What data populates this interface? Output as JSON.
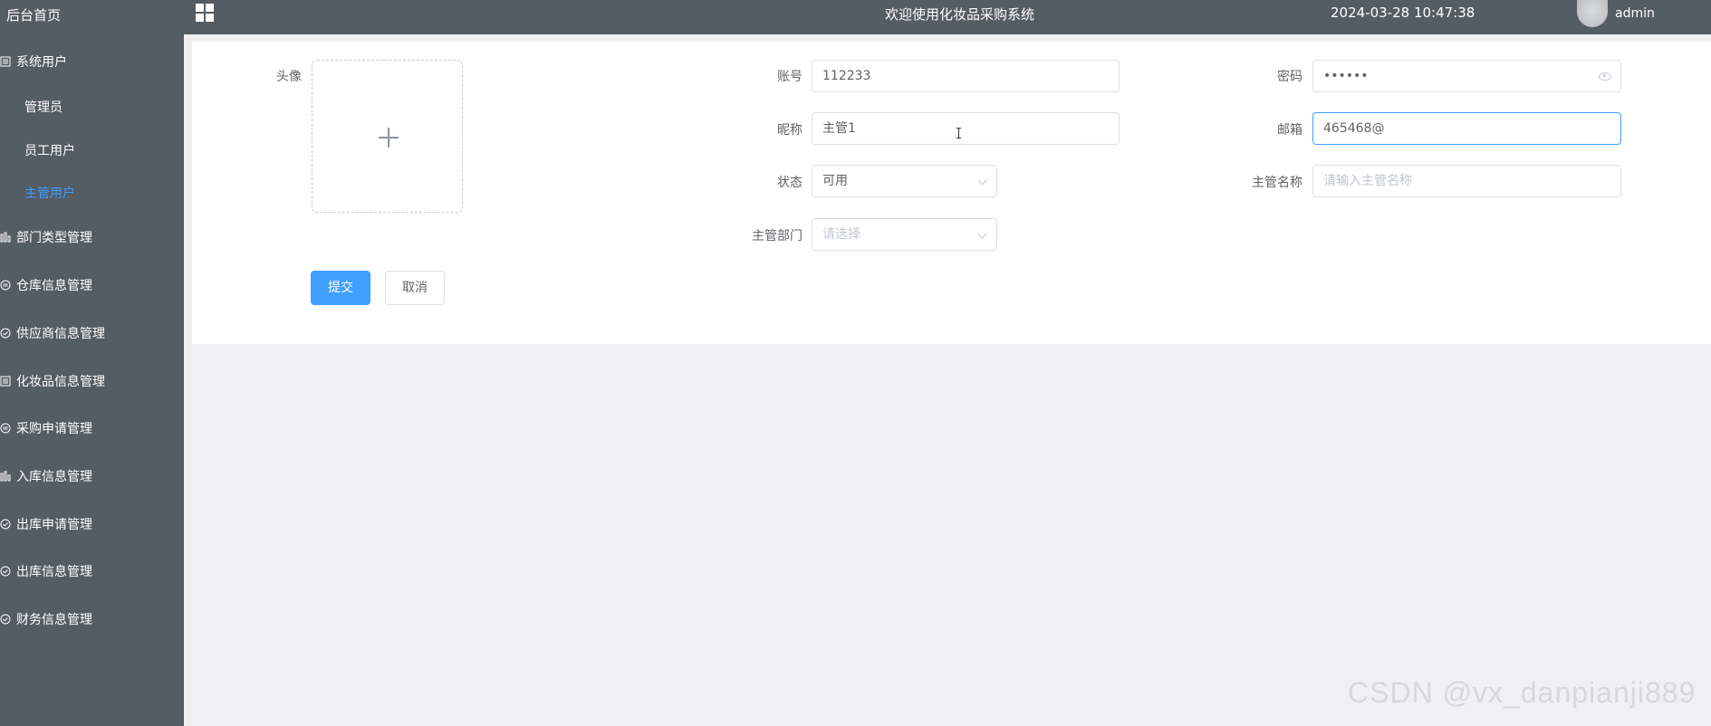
{
  "sidebar": {
    "home": "后台首页",
    "groups": [
      {
        "label": "系统用户",
        "icon": "list-icon"
      },
      {
        "label": "部门类型管理",
        "icon": "bar-chart-icon"
      },
      {
        "label": "仓库信息管理",
        "icon": "message-icon"
      },
      {
        "label": "供应商信息管理",
        "icon": "check-circle-icon"
      },
      {
        "label": "化妆品信息管理",
        "icon": "list-icon"
      },
      {
        "label": "采购申请管理",
        "icon": "message-icon"
      },
      {
        "label": "入库信息管理",
        "icon": "bar-chart-icon"
      },
      {
        "label": "出库申请管理",
        "icon": "check-circle-icon"
      },
      {
        "label": "出库信息管理",
        "icon": "check-circle-icon"
      },
      {
        "label": "财务信息管理",
        "icon": "check-circle-icon"
      }
    ],
    "sub_items": [
      "管理员",
      "员工用户",
      "主管用户"
    ],
    "active_sub": "主管用户",
    "active_color": "#409eff"
  },
  "header": {
    "title": "欢迎使用化妆品采购系统",
    "datetime": "2024-03-28 10:47:38",
    "username": "admin"
  },
  "form": {
    "avatar_label": "头像",
    "account_label": "账号",
    "account_value": "112233",
    "password_label": "密码",
    "password_value": "••••••",
    "nickname_label": "昵称",
    "nickname_value": "主管1",
    "email_label": "邮箱",
    "email_value": "465468@",
    "status_label": "状态",
    "status_value": "可用",
    "manager_name_label": "主管名称",
    "manager_name_placeholder": "请输入主管名称",
    "department_label": "主管部门",
    "department_placeholder": "请选择",
    "submit_label": "提交",
    "cancel_label": "取消"
  },
  "watermark": "CSDN @vx_danpianji889"
}
